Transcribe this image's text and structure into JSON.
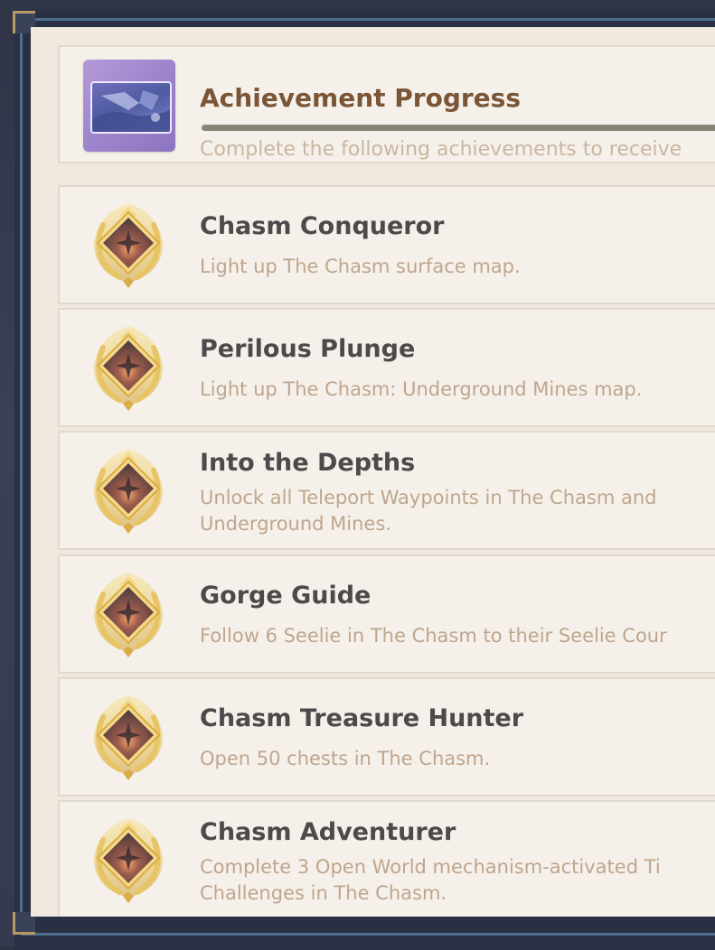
{
  "header": {
    "title": "Achievement Progress",
    "subtitle": "Complete the following achievements to receive",
    "progress_fraction": 1.0,
    "thumbnail_icon": "achievement-series-thumbnail-icon"
  },
  "achievements": [
    {
      "title": "Chasm Conqueror",
      "description": [
        "Light up The Chasm surface map."
      ],
      "icon": "gold-laurel-badge-icon"
    },
    {
      "title": "Perilous Plunge",
      "description": [
        "Light up The Chasm: Underground Mines map."
      ],
      "icon": "gold-laurel-badge-icon"
    },
    {
      "title": "Into the Depths",
      "description": [
        "Unlock all Teleport Waypoints in The Chasm and",
        "Underground Mines."
      ],
      "icon": "gold-laurel-badge-icon"
    },
    {
      "title": "Gorge Guide",
      "description": [
        "Follow 6 Seelie in The Chasm to their Seelie Cour"
      ],
      "icon": "gold-laurel-badge-icon"
    },
    {
      "title": "Chasm Treasure Hunter",
      "description": [
        "Open 50 chests in The Chasm."
      ],
      "icon": "gold-laurel-badge-icon"
    },
    {
      "title": "Chasm Adventurer",
      "description": [
        "Complete 3 Open World mechanism-activated Ti",
        "Challenges in The Chasm."
      ],
      "icon": "gold-laurel-badge-icon"
    }
  ],
  "colors": {
    "title_brown": "#7a5637",
    "item_title": "#4c4a4a",
    "item_desc": "#bfa58d",
    "panel_bg": "#efe9e0",
    "badge_gold": "#e8c35a"
  }
}
